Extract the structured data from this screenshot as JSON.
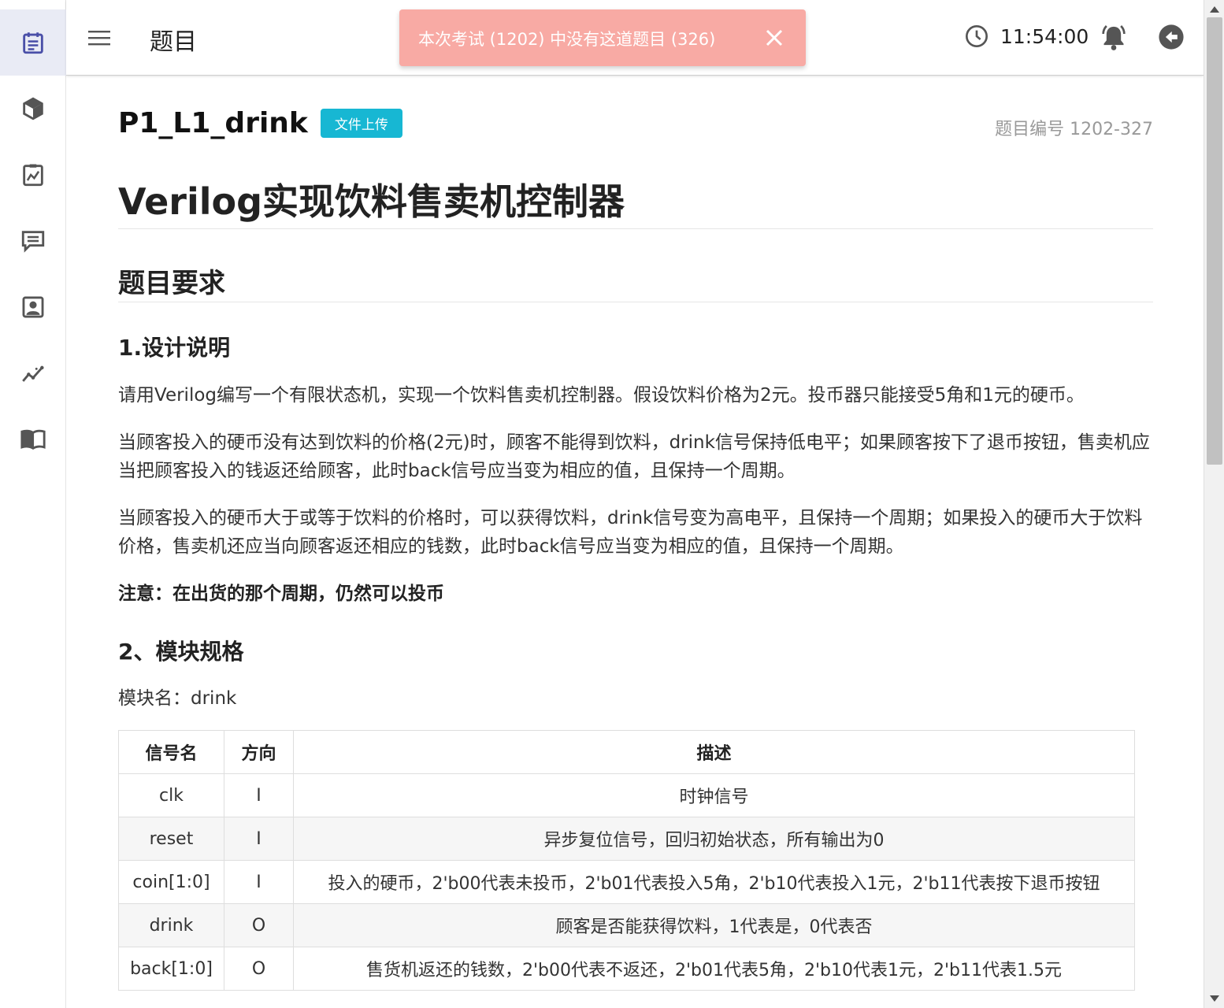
{
  "sidebar": {
    "items": [
      {
        "icon": "calendar-list-icon",
        "active": true
      },
      {
        "icon": "cube-icon",
        "active": false
      },
      {
        "icon": "clipboard-chart-icon",
        "active": false
      },
      {
        "icon": "message-icon",
        "active": false
      },
      {
        "icon": "contact-card-icon",
        "active": false
      },
      {
        "icon": "trending-icon",
        "active": false
      },
      {
        "icon": "open-book-icon",
        "active": false
      }
    ]
  },
  "header": {
    "title": "题目",
    "time": "11:54:00"
  },
  "toast": {
    "message": "本次考试 (1202) 中没有这道题目 (326)",
    "color": "#f8aaa4"
  },
  "question": {
    "name": "P1_L1_drink",
    "tag": "文件上传",
    "number_label": "题目编号 1202-327",
    "tag_color": "#17b7d3"
  },
  "article": {
    "title": "Verilog实现饮料售卖机控制器",
    "section_title": "题目要求",
    "sub1": "1.设计说明",
    "p1": "请用Verilog编写一个有限状态机，实现一个饮料售卖机控制器。假设饮料价格为2元。投币器只能接受5角和1元的硬币。",
    "p2": "当顾客投入的硬币没有达到饮料的价格(2元)时，顾客不能得到饮料，drink信号保持低电平；如果顾客按下了退币按钮，售卖机应当把顾客投入的钱返还给顾客，此时back信号应当变为相应的值，且保持一个周期。",
    "p3": "当顾客投入的硬币大于或等于饮料的价格时，可以获得饮料，drink信号变为高电平，且保持一个周期；如果投入的硬币大于饮料价格，售卖机还应当向顾客返还相应的钱数，此时back信号应当变为相应的值，且保持一个周期。",
    "note": "注意：在出货的那个周期，仍然可以投币",
    "sub2": "2、模块规格",
    "module_name": "模块名：drink"
  },
  "table": {
    "headers": [
      "信号名",
      "方向",
      "描述"
    ],
    "rows": [
      [
        "clk",
        "I",
        "时钟信号"
      ],
      [
        "reset",
        "I",
        "异步复位信号，回归初始状态，所有输出为0"
      ],
      [
        "coin[1:0]",
        "I",
        "投入的硬币，2'b00代表未投币，2'b01代表投入5角，2'b10代表投入1元，2'b11代表按下退币按钮"
      ],
      [
        "drink",
        "O",
        "顾客是否能获得饮料，1代表是，0代表否"
      ],
      [
        "back[1:0]",
        "O",
        "售货机返还的钱数，2'b00代表不返还，2'b01代表5角，2'b10代表1元，2'b11代表1.5元"
      ]
    ]
  }
}
